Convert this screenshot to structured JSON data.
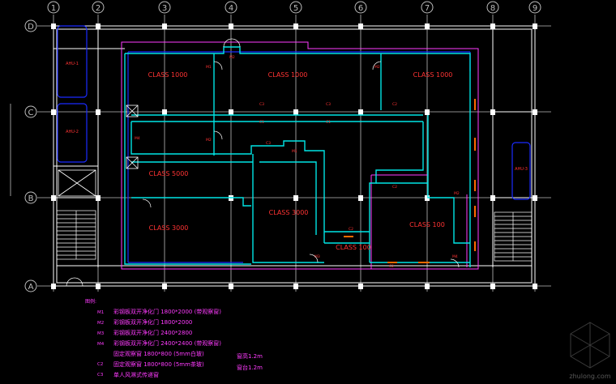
{
  "grid": {
    "columns": [
      "1",
      "2",
      "3",
      "4",
      "5",
      "6",
      "7",
      "8",
      "9"
    ],
    "rows": [
      "D",
      "C",
      "B",
      "A"
    ]
  },
  "rooms": [
    {
      "id": "r1",
      "label": "CLASS 1000"
    },
    {
      "id": "r2",
      "label": "CLASS 1000"
    },
    {
      "id": "r3",
      "label": "CLASS 1000"
    },
    {
      "id": "r4",
      "label": "CLASS 5000"
    },
    {
      "id": "r5",
      "label": "CLASS 3000"
    },
    {
      "id": "r6",
      "label": "CLASS 3000"
    },
    {
      "id": "r7",
      "label": "CLASS 100"
    },
    {
      "id": "r8",
      "label": "CLASS 100"
    }
  ],
  "ahu": [
    "AHU-1",
    "AHU-2",
    "AHU-3"
  ],
  "door_tags": [
    "M1",
    "M2",
    "M3",
    "M4"
  ],
  "window_tags": [
    "C1",
    "C2",
    "C3"
  ],
  "legend": {
    "title": "图例:",
    "items": [
      {
        "code": "M1",
        "text": "彩钢板双开净化门  1800*2000 (带观察窗)"
      },
      {
        "code": "M2",
        "text": "彩钢板双开净化门  1800*2000"
      },
      {
        "code": "M3",
        "text": "彩钢板双开净化门  2400*2800"
      },
      {
        "code": "M4",
        "text": "彩钢板双开净化门  2400*2400 (带观察窗)"
      },
      {
        "code": "C1",
        "text": "固定观察窗  1800*800 (5mm白玻)"
      },
      {
        "code": "C2",
        "text": "固定观察窗  1800*800 (5mm茶玻)"
      },
      {
        "code": "C3",
        "text": "单人风淋式传递窗"
      }
    ],
    "notes": [
      "窗高1.2m",
      "窗台1.2m"
    ]
  },
  "watermark": "zhulong.com",
  "colors": {
    "background": "#000000",
    "partition": "#00e5e5",
    "structure": "#ffffff",
    "outline": "#ff3bff",
    "room_text": "#ff3333",
    "blue_line": "#1a2bff",
    "legend_text": "#ff3bff",
    "note_text": "#ff3bff",
    "tag_text": "#ff3333",
    "window_mark": "#ff6a00",
    "ahu": "#1a2bff",
    "axis": "#bdbdbd"
  }
}
